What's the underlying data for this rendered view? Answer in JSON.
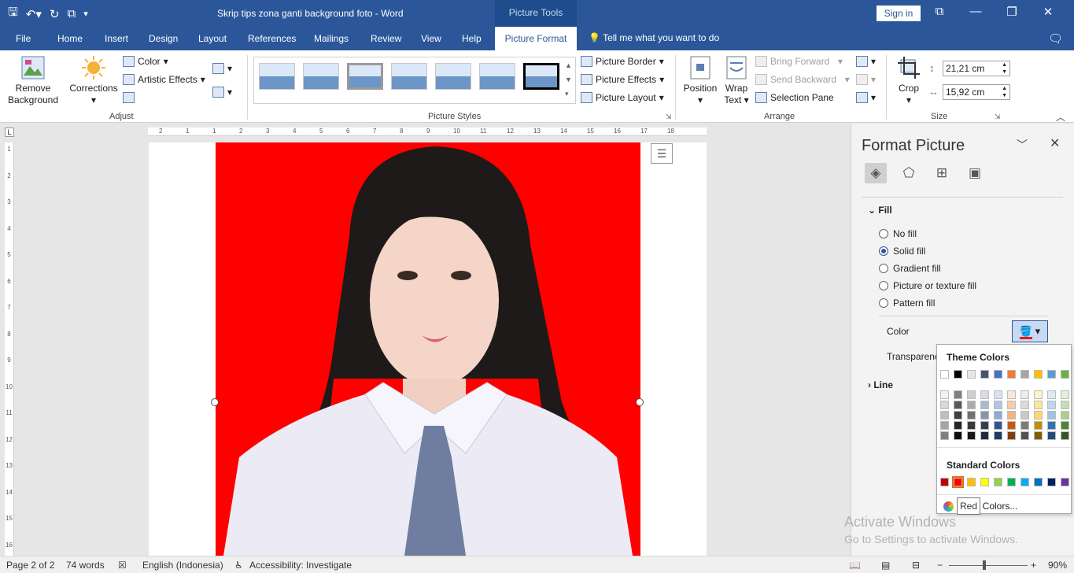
{
  "window": {
    "title": "Skrip tips zona ganti background foto  -  Word",
    "context_tab_group": "Picture Tools",
    "sign_in": "Sign in"
  },
  "tabs": [
    "File",
    "Home",
    "Insert",
    "Design",
    "Layout",
    "References",
    "Mailings",
    "Review",
    "View",
    "Help"
  ],
  "active_tab": "Picture Format",
  "tell_me": "Tell me what you want to do",
  "ribbon": {
    "adjust": {
      "remove_background_1": "Remove",
      "remove_background_2": "Background",
      "corrections": "Corrections",
      "color": "Color",
      "artistic_effects": "Artistic Effects",
      "label": "Adjust"
    },
    "picture_styles": {
      "label": "Picture Styles",
      "border": "Picture Border",
      "effects": "Picture Effects",
      "layout": "Picture Layout"
    },
    "arrange": {
      "position": "Position",
      "wrap_1": "Wrap",
      "wrap_2": "Text",
      "bring_forward": "Bring Forward",
      "send_backward": "Send Backward",
      "selection_pane": "Selection Pane",
      "label": "Arrange"
    },
    "size": {
      "crop": "Crop",
      "height": "21,21 cm",
      "width": "15,92 cm",
      "label": "Size"
    }
  },
  "ruler": {
    "h_ticks": [
      "2",
      "1",
      "1",
      "2",
      "3",
      "4",
      "5",
      "6",
      "7",
      "8",
      "9",
      "10",
      "11",
      "12",
      "13",
      "14",
      "15",
      "16",
      "17",
      "18"
    ],
    "v_ticks": [
      "1",
      "2",
      "3",
      "4",
      "5",
      "6",
      "7",
      "8",
      "9",
      "10",
      "11",
      "12",
      "13",
      "14",
      "15",
      "16"
    ]
  },
  "pane": {
    "title": "Format Picture",
    "fill_section": "Fill",
    "options": [
      "No fill",
      "Solid fill",
      "Gradient fill",
      "Picture or texture fill",
      "Pattern fill"
    ],
    "selected_option": 1,
    "color_label": "Color",
    "transparency_label": "Transparency",
    "line_section": "Line"
  },
  "color_popup": {
    "theme_header": "Theme Colors",
    "standard_header": "Standard Colors",
    "more_colors": "More Colors...",
    "tooltip": "Red",
    "theme_top": [
      "#ffffff",
      "#000000",
      "#e7e6e6",
      "#44546a",
      "#4472c4",
      "#ed7d31",
      "#a5a5a5",
      "#ffc000",
      "#5b9bd5",
      "#70ad47"
    ],
    "theme_shades": [
      [
        "#f2f2f2",
        "#7f7f7f",
        "#d0cece",
        "#d6dce4",
        "#d9e2f3",
        "#fbe5d5",
        "#ededed",
        "#fff2cc",
        "#deebf6",
        "#e2efd9"
      ],
      [
        "#d8d8d8",
        "#595959",
        "#aeabab",
        "#adb9ca",
        "#b4c6e7",
        "#f7cbac",
        "#dbdbdb",
        "#fee599",
        "#bdd7ee",
        "#c5e0b3"
      ],
      [
        "#bfbfbf",
        "#3f3f3f",
        "#757070",
        "#8496b0",
        "#8eaadb",
        "#f4b183",
        "#c9c9c9",
        "#ffd965",
        "#9cc3e5",
        "#a8d08d"
      ],
      [
        "#a5a5a5",
        "#262626",
        "#3a3838",
        "#323f4f",
        "#2f5496",
        "#c55a11",
        "#7b7b7b",
        "#bf9000",
        "#2e75b5",
        "#538135"
      ],
      [
        "#7f7f7f",
        "#0c0c0c",
        "#171616",
        "#222a35",
        "#1f3864",
        "#833c0b",
        "#525252",
        "#7f6000",
        "#1e4e79",
        "#375623"
      ]
    ],
    "standard": [
      "#c00000",
      "#ff0000",
      "#ffc000",
      "#ffff00",
      "#92d050",
      "#00b050",
      "#00b0f0",
      "#0070c0",
      "#002060",
      "#7030a0"
    ],
    "selected_standard": 1
  },
  "watermark": {
    "line1": "Activate Windows",
    "line2": "Go to Settings to activate Windows."
  },
  "status": {
    "page": "Page 2 of 2",
    "words": "74 words",
    "language": "English (Indonesia)",
    "accessibility": "Accessibility: Investigate",
    "zoom": "90%"
  },
  "colors": {
    "word_blue": "#2b579a",
    "photo_background": "#ff0000"
  }
}
